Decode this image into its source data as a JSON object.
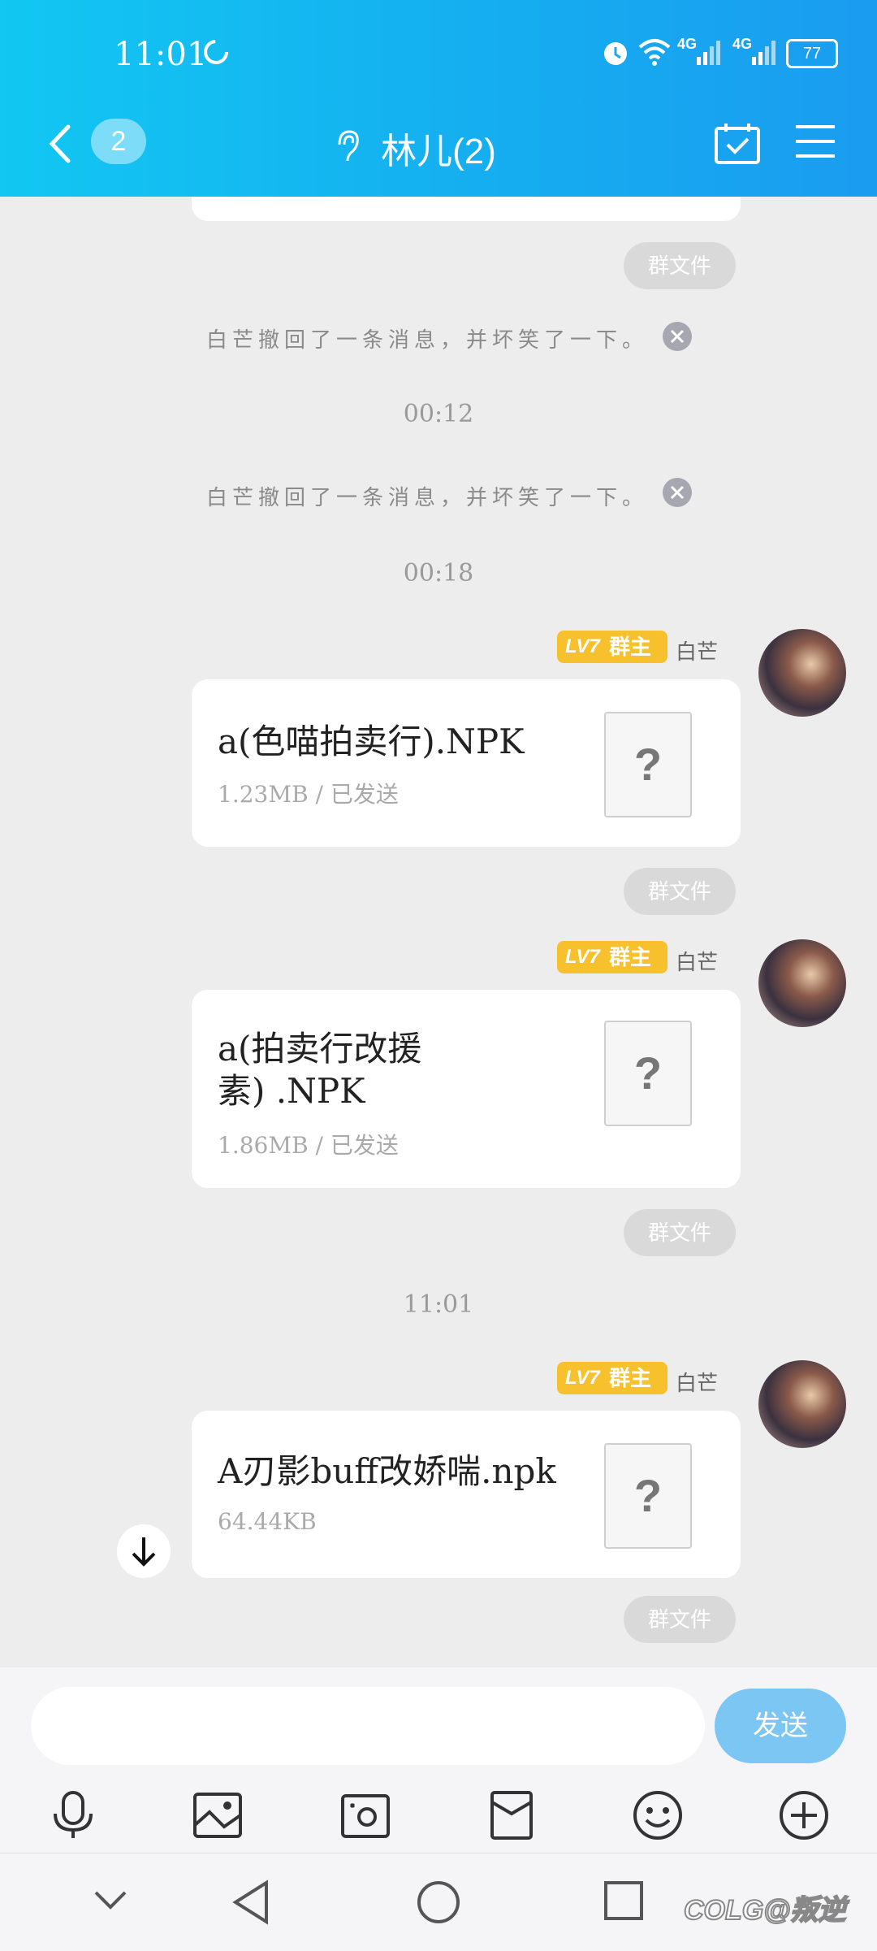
{
  "status_bar": {
    "time": "11:01",
    "signal_1": "4G",
    "signal_2": "4G",
    "battery": "77"
  },
  "header": {
    "back_count": "2",
    "title": "林儿(2)"
  },
  "messages": {
    "pill_label": "群文件",
    "recall_1": "白芒撤回了一条消息，并坏笑了一下。",
    "time_1": "00:12",
    "recall_2": "白芒撤回了一条消息，并坏笑了一下。",
    "time_2": "00:18",
    "time_3": "11:01",
    "level": "LV7",
    "role": "群主",
    "sender": "白芒",
    "files": [
      {
        "name": "a(色喵拍卖行).NPK",
        "meta": "1.23MB / 已发送"
      },
      {
        "name_line1": "a(拍卖行改援",
        "name_line2": "素) .NPK",
        "meta": "1.86MB / 已发送"
      },
      {
        "name": "A刃影buff改娇喘.npk",
        "meta": "64.44KB"
      }
    ]
  },
  "composer": {
    "input_value": "",
    "send_label": "发送"
  },
  "watermark": "COLG@叛逆"
}
